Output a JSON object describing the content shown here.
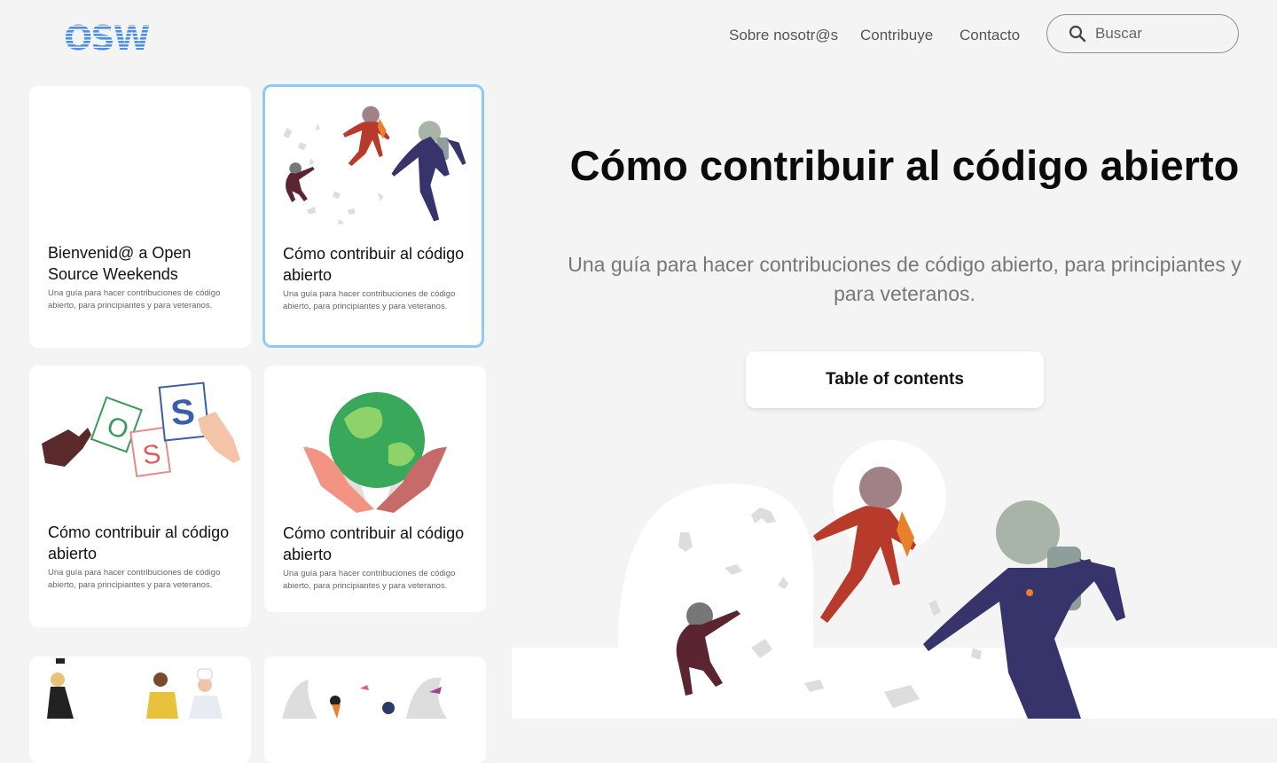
{
  "header": {
    "logo_text": "OSW",
    "nav": [
      {
        "label": "Sobre nosotr@s"
      },
      {
        "label": "Contribuye"
      },
      {
        "label": "Contacto"
      }
    ],
    "search": {
      "placeholder": "Buscar",
      "icon": "search-icon"
    }
  },
  "cards": [
    {
      "title": "Bienvenid@ a Open Source Weekends",
      "description": "Una guía para hacer contribuciones de código abierto, para principiantes y para veteranos.",
      "illustration": "none"
    },
    {
      "title": "Cómo contribuir al código abierto",
      "description": "Una guía para hacer contribuciones de código abierto, para principiantes y para veteranos.",
      "illustration": "astronauts-illustration",
      "active": true
    },
    {
      "title": "Cómo contribuir al código abierto",
      "description": "Una guía para hacer contribuciones de código abierto, para principiantes y para veteranos.",
      "illustration": "letter-cards-illustration",
      "letters": [
        "O",
        "S",
        "S"
      ]
    },
    {
      "title": "Cómo contribuir al código abierto",
      "description": "Una guía para hacer contribuciones de código abierto, para principiantes y para veteranos.",
      "illustration": "globe-hands-illustration"
    },
    {
      "illustration": "people-illustration"
    },
    {
      "illustration": "jungle-illustration"
    }
  ],
  "hero": {
    "title": "Cómo contribuir al código abierto",
    "subtitle": "Una guía para hacer contribuciones de código abierto, para principiantes y para veteranos.",
    "toc_label": "Table of contents",
    "illustration": "astronauts-illustration"
  },
  "colors": {
    "background": "#f4f4f4",
    "active_border": "#8fcaf5",
    "logo_blue": "#4a8ee6"
  }
}
